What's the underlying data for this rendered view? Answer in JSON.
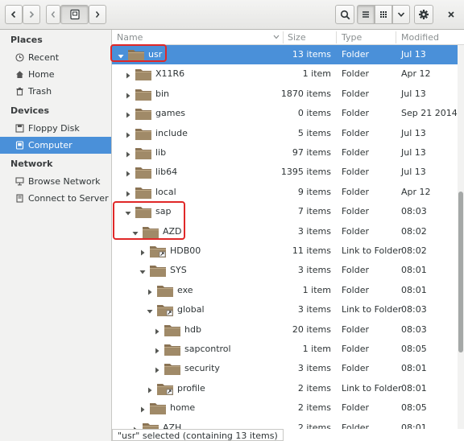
{
  "sidebar": {
    "sections": [
      {
        "header": "Places",
        "items": [
          {
            "label": "Recent",
            "icon": "clock-icon"
          },
          {
            "label": "Home",
            "icon": "home-icon"
          },
          {
            "label": "Trash",
            "icon": "trash-icon"
          }
        ]
      },
      {
        "header": "Devices",
        "items": [
          {
            "label": "Floppy Disk",
            "icon": "floppy-icon"
          },
          {
            "label": "Computer",
            "icon": "computer-icon",
            "active": true
          }
        ]
      },
      {
        "header": "Network",
        "items": [
          {
            "label": "Browse Network",
            "icon": "network-icon"
          },
          {
            "label": "Connect to Server",
            "icon": "server-icon"
          }
        ]
      }
    ]
  },
  "columns": {
    "name": "Name",
    "size": "Size",
    "type": "Type",
    "modified": "Modified"
  },
  "rows": [
    {
      "name": "usr",
      "size": "13 items",
      "type": "Folder",
      "modified": "Jul 13",
      "level": 0,
      "expanded": true,
      "selected": true
    },
    {
      "name": "X11R6",
      "size": "1 item",
      "type": "Folder",
      "modified": "Apr 12",
      "level": 1,
      "expanded": false
    },
    {
      "name": "bin",
      "size": "1870 items",
      "type": "Folder",
      "modified": "Jul 13",
      "level": 1,
      "expanded": false
    },
    {
      "name": "games",
      "size": "0 items",
      "type": "Folder",
      "modified": "Sep 21 2014",
      "level": 1,
      "expanded": false
    },
    {
      "name": "include",
      "size": "5 items",
      "type": "Folder",
      "modified": "Jul 13",
      "level": 1,
      "expanded": false
    },
    {
      "name": "lib",
      "size": "97 items",
      "type": "Folder",
      "modified": "Jul 13",
      "level": 1,
      "expanded": false
    },
    {
      "name": "lib64",
      "size": "1395 items",
      "type": "Folder",
      "modified": "Jul 13",
      "level": 1,
      "expanded": false
    },
    {
      "name": "local",
      "size": "9 items",
      "type": "Folder",
      "modified": "Apr 12",
      "level": 1,
      "expanded": false
    },
    {
      "name": "sap",
      "size": "7 items",
      "type": "Folder",
      "modified": "08:03",
      "level": 1,
      "expanded": true
    },
    {
      "name": "AZD",
      "size": "3 items",
      "type": "Folder",
      "modified": "08:02",
      "level": 2,
      "expanded": true
    },
    {
      "name": "HDB00",
      "size": "11 items",
      "type": "Link to Folder",
      "modified": "08:02",
      "level": 3,
      "expanded": false,
      "link": true
    },
    {
      "name": "SYS",
      "size": "3 items",
      "type": "Folder",
      "modified": "08:01",
      "level": 3,
      "expanded": true
    },
    {
      "name": "exe",
      "size": "1 item",
      "type": "Folder",
      "modified": "08:01",
      "level": 4,
      "expanded": false
    },
    {
      "name": "global",
      "size": "3 items",
      "type": "Link to Folder",
      "modified": "08:03",
      "level": 4,
      "expanded": true,
      "link": true
    },
    {
      "name": "hdb",
      "size": "20 items",
      "type": "Folder",
      "modified": "08:03",
      "level": 5,
      "expanded": false
    },
    {
      "name": "sapcontrol",
      "size": "1 item",
      "type": "Folder",
      "modified": "08:05",
      "level": 5,
      "expanded": false
    },
    {
      "name": "security",
      "size": "3 items",
      "type": "Folder",
      "modified": "08:01",
      "level": 5,
      "expanded": false
    },
    {
      "name": "profile",
      "size": "2 items",
      "type": "Link to Folder",
      "modified": "08:01",
      "level": 4,
      "expanded": false,
      "link": true
    },
    {
      "name": "home",
      "size": "2 items",
      "type": "Folder",
      "modified": "08:05",
      "level": 3,
      "expanded": false
    },
    {
      "name": "AZH",
      "size": "2 items",
      "type": "Folder",
      "modified": "08:01",
      "level": 2,
      "expanded": false
    }
  ],
  "status": "\"usr\" selected (containing 13 items)",
  "colors": {
    "selection": "#4a90d9",
    "folder": "#a08a68",
    "annotation": "#e02828"
  }
}
